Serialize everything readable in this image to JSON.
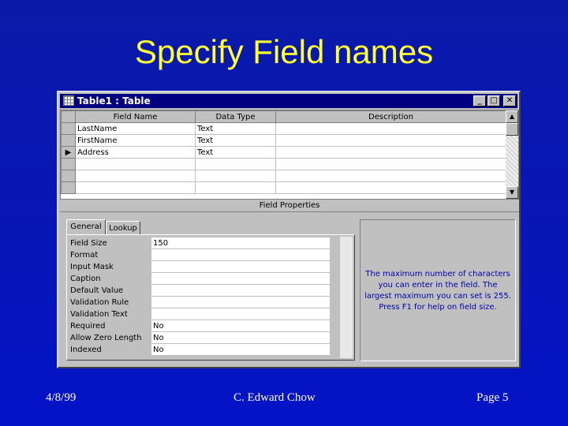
{
  "slide": {
    "title": "Specify Field names",
    "footer_date": "4/8/99",
    "footer_author": "C. Edward Chow",
    "footer_page": "Page 5"
  },
  "window": {
    "title": "Table1 : Table",
    "icon": "table-icon",
    "buttons": {
      "minimize": "_",
      "maximize": "□",
      "close": "✕"
    }
  },
  "grid": {
    "columns": [
      "Field Name",
      "Data Type",
      "Description"
    ],
    "rows": [
      {
        "field": "LastName",
        "type": "Text",
        "desc": ""
      },
      {
        "field": "FirstName",
        "type": "Text",
        "desc": ""
      },
      {
        "field": "Address",
        "type": "Text",
        "desc": ""
      },
      {
        "field": "",
        "type": "",
        "desc": ""
      },
      {
        "field": "",
        "type": "",
        "desc": ""
      },
      {
        "field": "",
        "type": "",
        "desc": ""
      }
    ],
    "current_row_marker": "▶"
  },
  "field_properties": {
    "header": "Field Properties",
    "tabs": [
      "General",
      "Lookup"
    ],
    "active_tab": "General",
    "properties": [
      {
        "label": "Field Size",
        "value": "150"
      },
      {
        "label": "Format",
        "value": ""
      },
      {
        "label": "Input Mask",
        "value": ""
      },
      {
        "label": "Caption",
        "value": ""
      },
      {
        "label": "Default Value",
        "value": ""
      },
      {
        "label": "Validation Rule",
        "value": ""
      },
      {
        "label": "Validation Text",
        "value": ""
      },
      {
        "label": "Required",
        "value": "No"
      },
      {
        "label": "Allow Zero Length",
        "value": "No"
      },
      {
        "label": "Indexed",
        "value": "No"
      }
    ],
    "help_text": "The maximum number of characters you can enter in the field. The largest maximum you can set is 255. Press F1 for help on field size."
  },
  "colors": {
    "background": "#0716b8",
    "title": "#ffff33",
    "titlebar": "#000080",
    "help_text": "#0000aa"
  }
}
